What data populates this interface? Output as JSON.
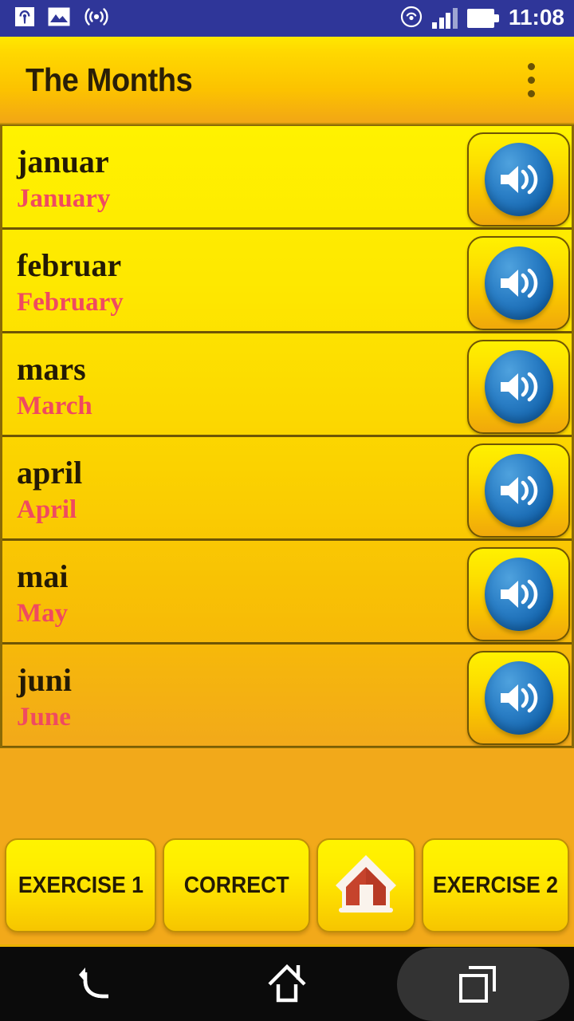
{
  "status_bar": {
    "clock": "11:08",
    "left_icons": [
      "cast-screen-icon",
      "image-icon",
      "wireless-signal-icon"
    ],
    "right_icons": [
      "nfc-broadcast-icon",
      "cellular-signal-icon",
      "battery-full-icon"
    ],
    "background_color": "#2F3699",
    "foreground_color": "#FFFFFF"
  },
  "app_bar": {
    "title": "The Months",
    "overflow_icon": "overflow-menu-icon",
    "gradient_top": "#FFE800",
    "gradient_bottom": "#F2A615",
    "title_color": "#2A1F07"
  },
  "list": {
    "native_color": "#241A05",
    "translation_color": "#F04A60",
    "divider_color": "#6E5504",
    "speaker_icon": "speaker-volume-icon",
    "rows": [
      {
        "native": "januar",
        "translation": "January"
      },
      {
        "native": "februar",
        "translation": "February"
      },
      {
        "native": "mars",
        "translation": "March"
      },
      {
        "native": "april",
        "translation": "April"
      },
      {
        "native": "mai",
        "translation": "May"
      },
      {
        "native": "juni",
        "translation": "June"
      }
    ]
  },
  "button_bar": {
    "exercise1": "EXERCISE 1",
    "correct": "CORRECT",
    "home_icon": "home-house-icon",
    "exercise2": "EXERCISE 2",
    "button_color": "#FFEC00",
    "label_color": "#241A05"
  },
  "nav_bar": {
    "back_icon": "back-arrow-icon",
    "home_icon": "home-outline-icon",
    "recents_icon": "recent-apps-icon",
    "background_color": "#0B0B0B"
  }
}
